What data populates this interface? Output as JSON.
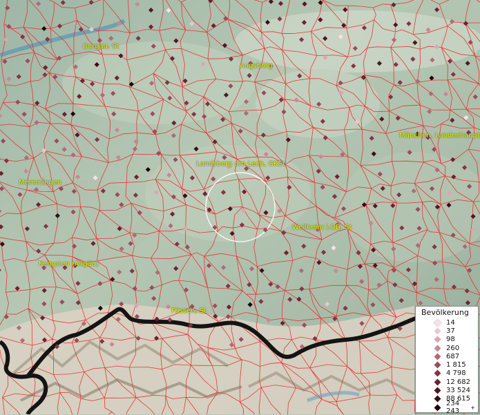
{
  "map": {
    "places": [
      {
        "name": "Burgau, St"
      },
      {
        "name": "Augsburg"
      },
      {
        "name": "München, Landeshaupts"
      },
      {
        "name": "Landsberg am Lech, GKSt"
      },
      {
        "name": "Memmingen"
      },
      {
        "name": "Weilheim i.OB, St"
      },
      {
        "name": "Kempten (Allgäu)"
      },
      {
        "name": "Füssen, St"
      }
    ],
    "colors": {
      "terrain": "#a9bfae",
      "boundary": "#e8302e",
      "alps": "#d8d0c4",
      "border": "#141414",
      "label": "#f0f000"
    }
  },
  "legend": {
    "title": "Bevölkerung",
    "items": [
      {
        "label": "14",
        "color": "#f7e1ea"
      },
      {
        "label": "37",
        "color": "#e9c7d1"
      },
      {
        "label": "98",
        "color": "#d9a8b4"
      },
      {
        "label": "260",
        "color": "#c68995"
      },
      {
        "label": "687",
        "color": "#b06a78"
      },
      {
        "label": "1 815",
        "color": "#9a4c5c"
      },
      {
        "label": "4 798",
        "color": "#833445"
      },
      {
        "label": "12 682",
        "color": "#6b2232"
      },
      {
        "label": "33 524",
        "color": "#521523"
      },
      {
        "label": "88 615",
        "color": "#3a0b16"
      },
      {
        "label": "234 243",
        "color": "#1e0308",
        "plus": "+"
      }
    ]
  }
}
